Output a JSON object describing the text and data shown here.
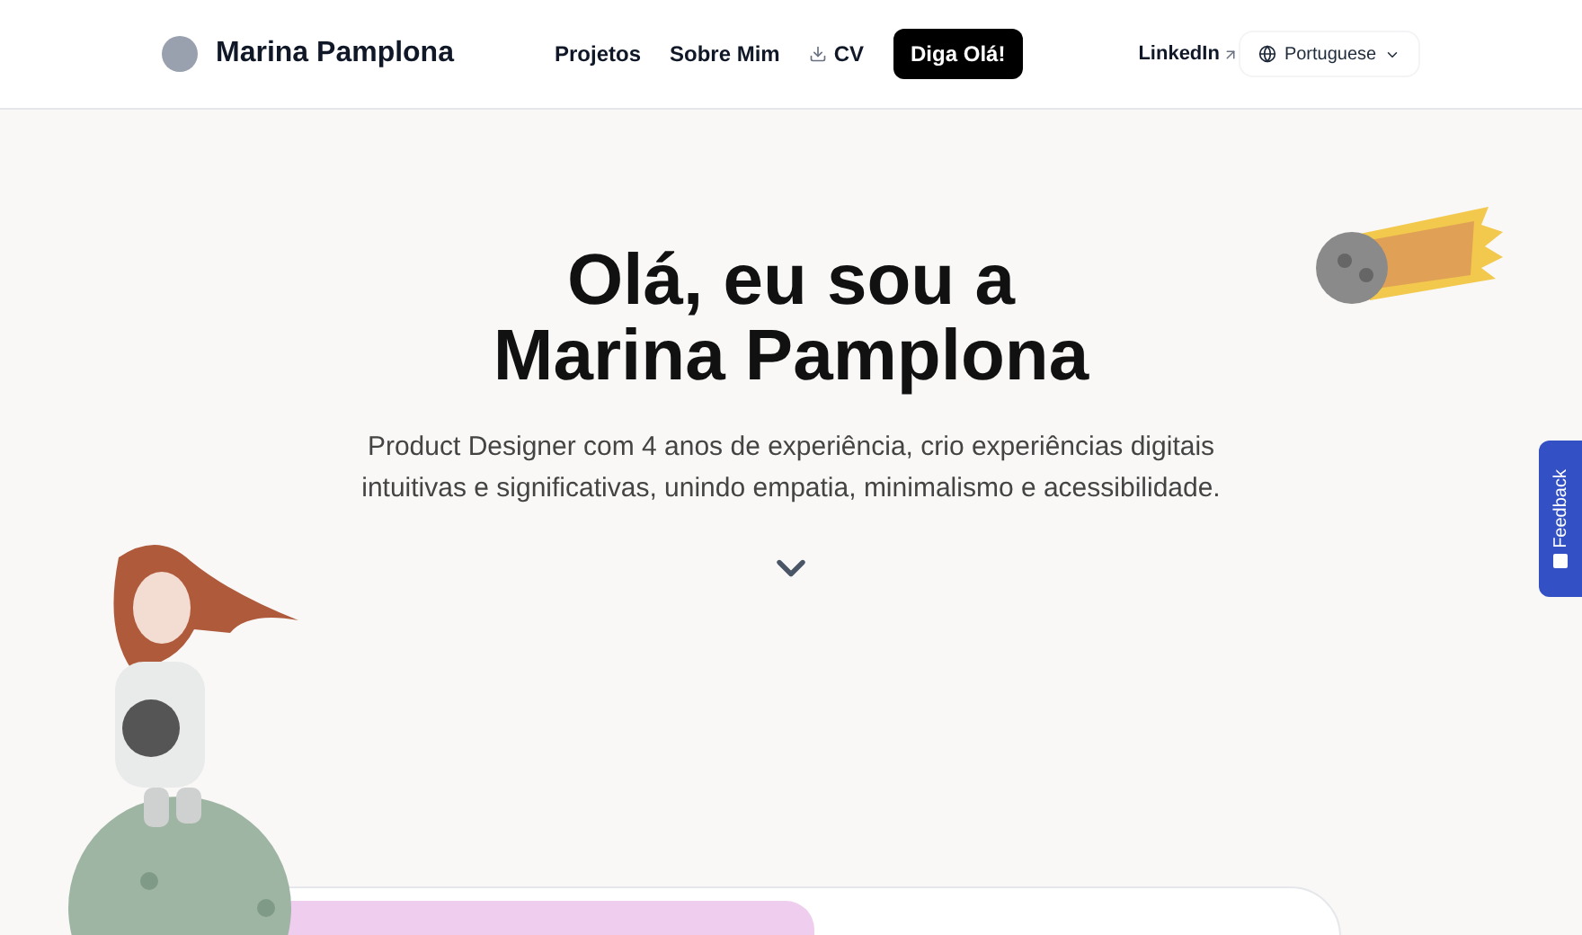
{
  "header": {
    "name": "Marina Pamplona",
    "nav": [
      {
        "label": "Projetos",
        "kind": "link"
      },
      {
        "label": "Sobre Mim",
        "kind": "link"
      },
      {
        "label": "CV",
        "kind": "download"
      },
      {
        "label": "Diga Olá!",
        "kind": "primary"
      }
    ],
    "external_link": "LinkedIn",
    "language": "Portuguese"
  },
  "hero": {
    "title_line_1": "Olá, eu sou a",
    "title_line_2": "Marina Pamplona",
    "subtitle": "Product Designer com 4 anos de experiência, crio experiências digitais intuitivas e significativas, unindo empatia, minimalismo e acessibilidade."
  },
  "feedback_tab": "Feedback"
}
